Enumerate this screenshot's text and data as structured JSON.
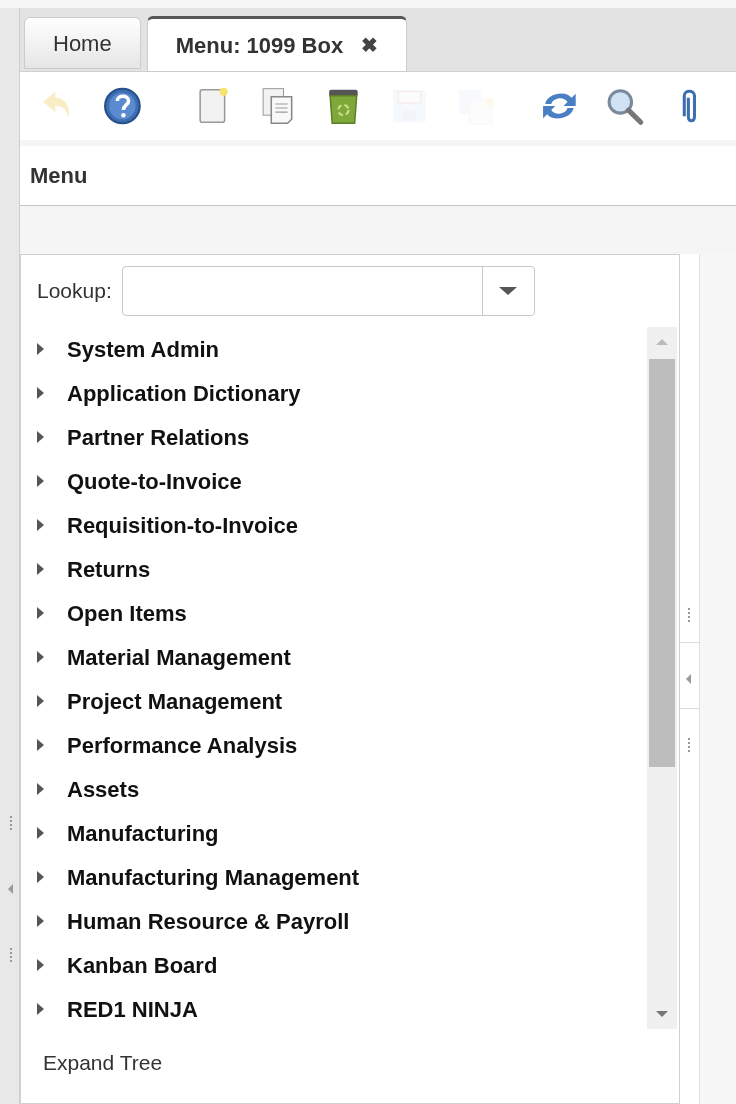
{
  "tabs": [
    {
      "label": "Home",
      "selected": false
    },
    {
      "label": "Menu: 1099 Box",
      "selected": true,
      "close_glyph": "✖"
    }
  ],
  "toolbar": [
    {
      "kind": "undo",
      "disabled": true
    },
    {
      "kind": "help",
      "disabled": false
    },
    {
      "kind": "new",
      "disabled": false
    },
    {
      "kind": "copy",
      "disabled": false
    },
    {
      "kind": "delete",
      "disabled": false
    },
    {
      "kind": "save",
      "disabled": true
    },
    {
      "kind": "save-new",
      "disabled": true
    },
    {
      "kind": "refresh",
      "disabled": false
    },
    {
      "kind": "find",
      "disabled": false
    },
    {
      "kind": "attach",
      "disabled": false
    }
  ],
  "panel_title": "Menu",
  "lookup": {
    "label": "Lookup:"
  },
  "tree": [
    {
      "label": "System Admin",
      "expanded": false
    },
    {
      "label": "Application Dictionary",
      "expanded": false
    },
    {
      "label": "Partner Relations",
      "expanded": false
    },
    {
      "label": "Quote-to-Invoice",
      "expanded": false
    },
    {
      "label": "Requisition-to-Invoice",
      "expanded": false
    },
    {
      "label": "Returns",
      "expanded": false
    },
    {
      "label": "Open Items",
      "expanded": false
    },
    {
      "label": "Material Management",
      "expanded": false
    },
    {
      "label": "Project Management",
      "expanded": false
    },
    {
      "label": "Performance Analysis",
      "expanded": false
    },
    {
      "label": "Assets",
      "expanded": false
    },
    {
      "label": "Manufacturing",
      "expanded": false
    },
    {
      "label": "Manufacturing Management",
      "expanded": false
    },
    {
      "label": "Human Resource & Payroll",
      "expanded": false
    },
    {
      "label": "Kanban Board",
      "expanded": false
    },
    {
      "label": "RED1 NINJA",
      "expanded": false
    }
  ],
  "expand_tree": {
    "label": "Expand Tree",
    "checked": false
  }
}
